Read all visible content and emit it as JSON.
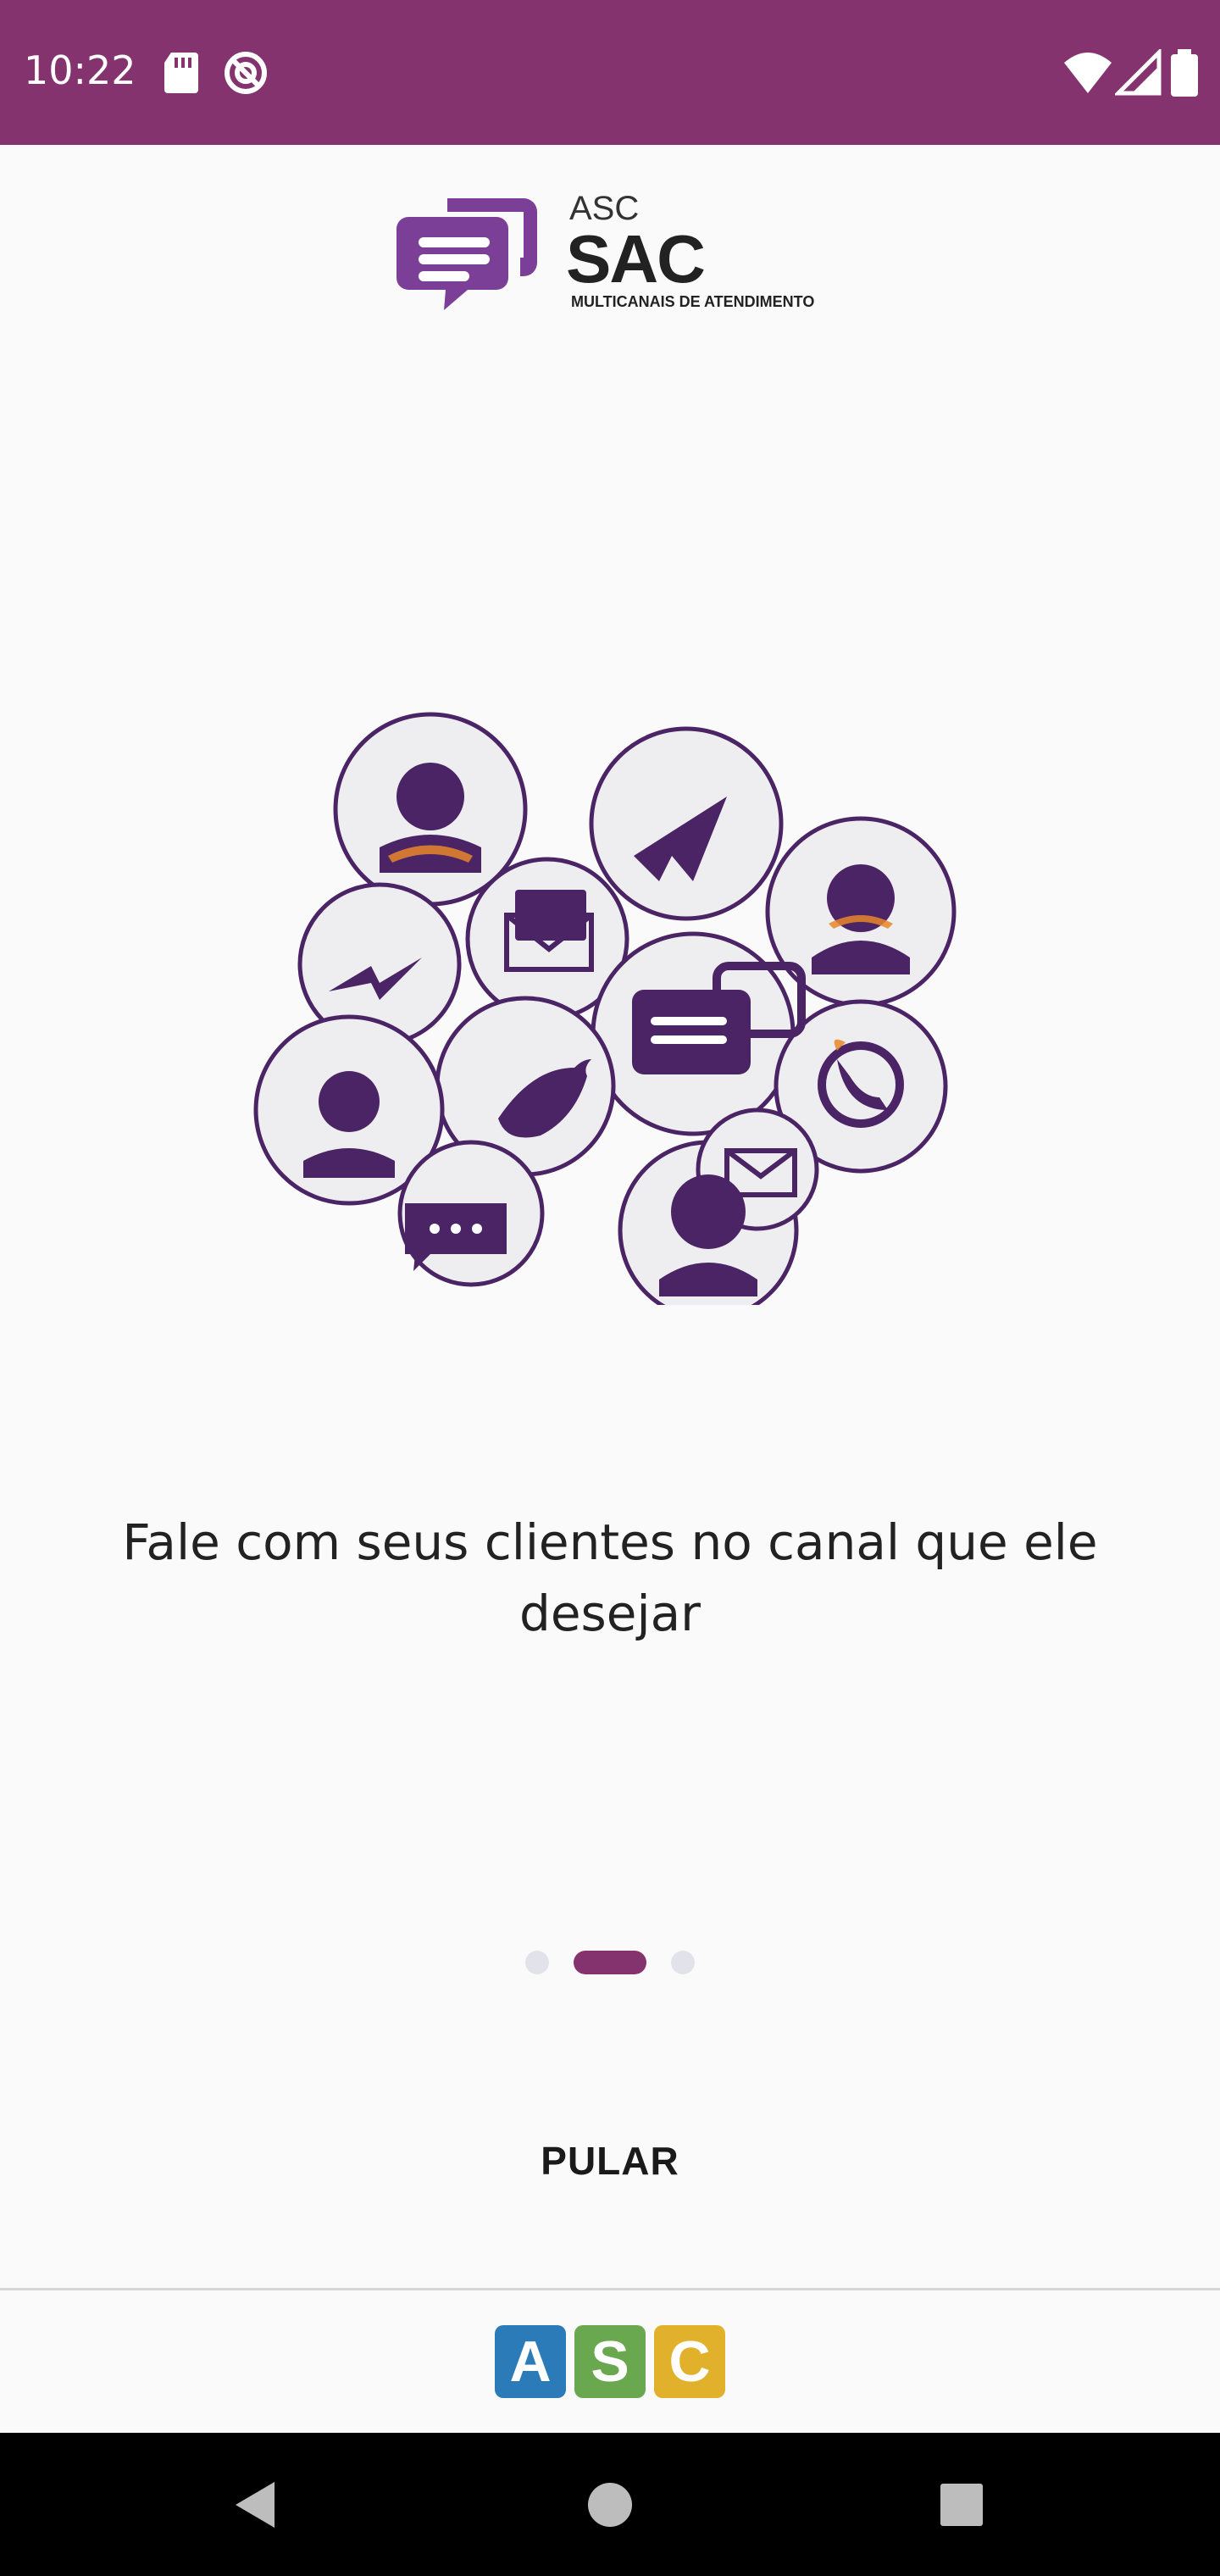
{
  "status_bar": {
    "time": "10:22",
    "background": "#84336f",
    "left_icons": [
      "sd-card-icon",
      "do-not-disturb-icon"
    ],
    "right_icons": [
      "wifi-icon",
      "signal-icon",
      "battery-icon"
    ]
  },
  "logo": {
    "asc": "ASC",
    "sac": "SAC",
    "tagline": "MULTICANAIS DE ATENDIMENTO",
    "brand_color": "#7b3f98"
  },
  "onboarding": {
    "caption": "Fale com seus clientes no canal que ele desejar",
    "page_count": 3,
    "current_page": 2,
    "active_color": "#84336f",
    "inactive_color": "#e2e3ea"
  },
  "actions": {
    "skip_label": "PULAR"
  },
  "footer": {
    "tiles": [
      {
        "letter": "A",
        "color": "#2b7bb9"
      },
      {
        "letter": "S",
        "color": "#6aa84f"
      },
      {
        "letter": "C",
        "color": "#e1b12c"
      }
    ]
  },
  "nav_bar": {
    "buttons": [
      "back-icon",
      "home-icon",
      "recents-icon"
    ]
  }
}
